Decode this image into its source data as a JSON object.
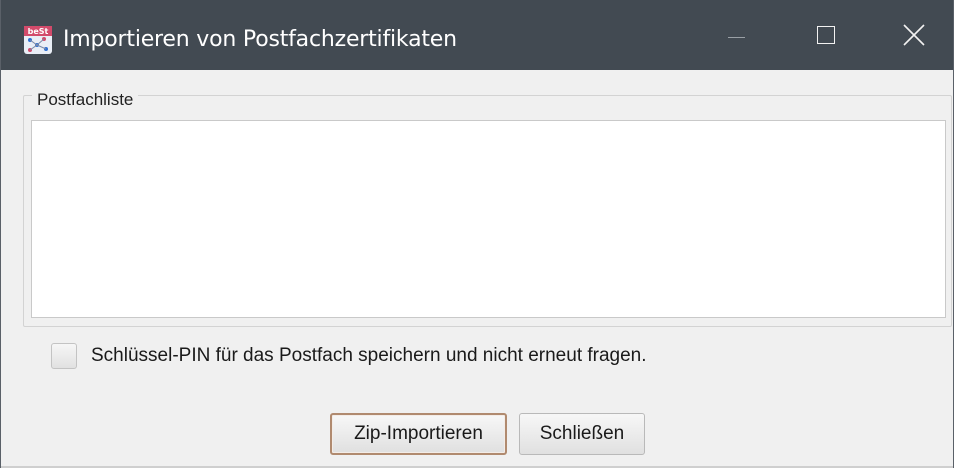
{
  "window": {
    "title": "Importieren von Postfachzertifikaten",
    "app_icon_text": "beSt",
    "controls": {
      "minimize": "minimize",
      "maximize": "maximize",
      "close": "close"
    }
  },
  "group": {
    "legend": "Postfachliste",
    "items": []
  },
  "options": {
    "save_pin_label": "Schlüssel-PIN für das Postfach speichern und nicht erneut fragen.",
    "save_pin_checked": false
  },
  "buttons": {
    "import_label": "Zip-Importieren",
    "close_label": "Schließen"
  },
  "colors": {
    "titlebar": "#424a52",
    "default_button_border": "#b08a6f",
    "background": "#f0f0f0"
  }
}
